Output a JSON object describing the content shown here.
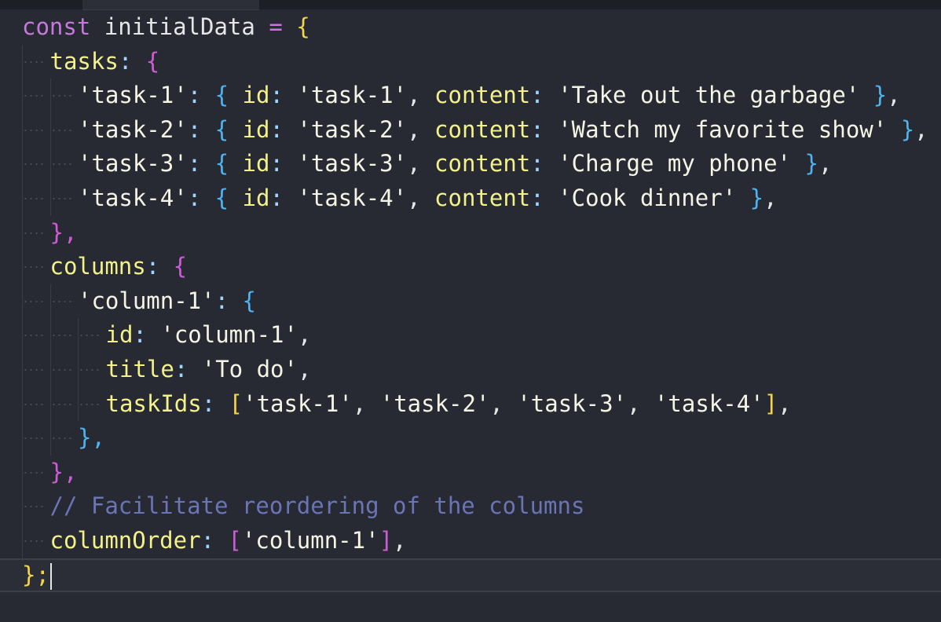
{
  "code": {
    "line1": {
      "keyword": "const",
      "name": "initialData",
      "op": "=",
      "brace": "{"
    },
    "line2": {
      "prop": "tasks",
      "colon": ":",
      "brace": "{"
    },
    "tasks": [
      {
        "key": "'task-1'",
        "id_key": "id",
        "id_val": "'task-1'",
        "content_key": "content",
        "content_val": "'Take out the garbage'"
      },
      {
        "key": "'task-2'",
        "id_key": "id",
        "id_val": "'task-2'",
        "content_key": "content",
        "content_val": "'Watch my favorite show'"
      },
      {
        "key": "'task-3'",
        "id_key": "id",
        "id_val": "'task-3'",
        "content_key": "content",
        "content_val": "'Charge my phone'"
      },
      {
        "key": "'task-4'",
        "id_key": "id",
        "id_val": "'task-4'",
        "content_key": "content",
        "content_val": "'Cook dinner'"
      }
    ],
    "tasks_close": "},",
    "columns_line": {
      "prop": "columns",
      "colon": ":",
      "brace": "{"
    },
    "column1_line": {
      "key": "'column-1'",
      "colon": ":",
      "brace": "{"
    },
    "column1_id": {
      "prop": "id",
      "val": "'column-1'"
    },
    "column1_title": {
      "prop": "title",
      "val": "'To do'"
    },
    "column1_taskIds": {
      "prop": "taskIds",
      "vals": [
        "'task-1'",
        "'task-2'",
        "'task-3'",
        "'task-4'"
      ]
    },
    "column1_close": "},",
    "columns_close": "},",
    "comment": "// Facilitate reordering of the columns",
    "columnOrder": {
      "prop": "columnOrder",
      "val": "'column-1'"
    },
    "final": "};"
  },
  "colors": {
    "background": "#272933",
    "keyword": "#c678dd",
    "string": "#f5f5e6",
    "property": "#f3f18a",
    "comment": "#6a75b6",
    "brace_yellow": "#f5d547",
    "brace_purple": "#cf5cd6",
    "brace_blue": "#4fb3f0"
  }
}
